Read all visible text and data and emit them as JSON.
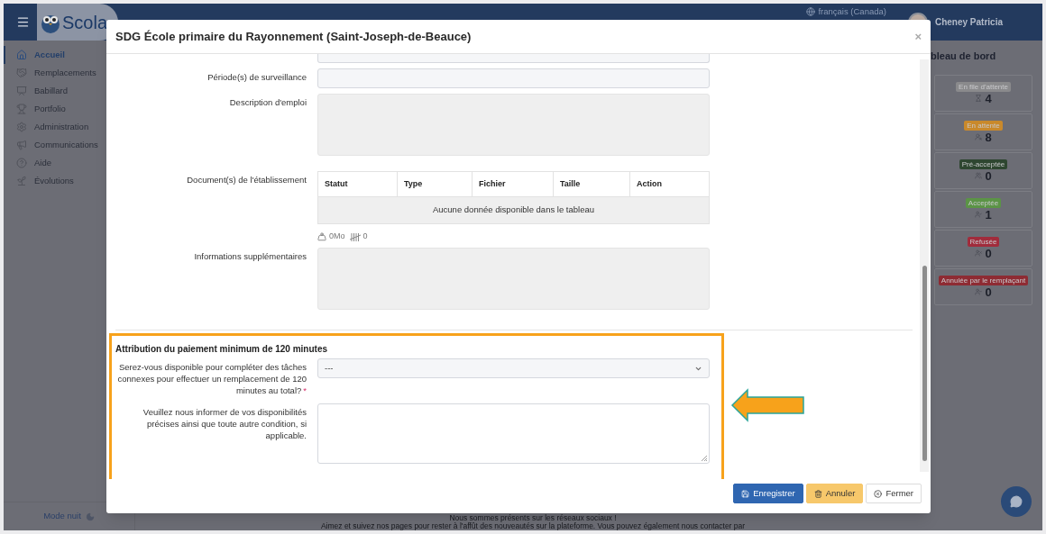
{
  "app": {
    "brand": "Scola",
    "language": "français (Canada)",
    "user": "Cheney Patricia"
  },
  "sidebar": {
    "items": [
      {
        "label": "Accueil",
        "selected": true
      },
      {
        "label": "Remplacements",
        "selected": false
      },
      {
        "label": "Babillard",
        "selected": false
      },
      {
        "label": "Portfolio",
        "selected": false
      },
      {
        "label": "Administration",
        "selected": false
      },
      {
        "label": "Communications",
        "selected": false
      },
      {
        "label": "Aide",
        "selected": false
      },
      {
        "label": "Évolutions",
        "selected": false
      }
    ],
    "night_mode": "Mode nuit"
  },
  "dashboard": {
    "title": "bleau de bord",
    "cards": [
      {
        "label": "En file d'attente",
        "count": "4",
        "color": "#8a8a8c"
      },
      {
        "label": "En attente",
        "count": "8",
        "color": "#c9892b"
      },
      {
        "label": "Pré-acceptée",
        "count": "0",
        "color": "#2e4630"
      },
      {
        "label": "Acceptée",
        "count": "1",
        "color": "#5b9446"
      },
      {
        "label": "Refusée",
        "count": "0",
        "color": "#a12c3c"
      },
      {
        "label": "Annulée par le remplaçant",
        "count": "0",
        "color": "#8e2b33"
      }
    ]
  },
  "footer_texts": [
    "Nous sommes présents sur les réseaux sociaux !",
    "Aimez et suivez nos pages pour rester à l'affût des nouveautés sur la plateforme. Vous pouvez également nous contacter par"
  ],
  "modal": {
    "title": "SDG École primaire du Rayonnement (Saint-Joseph-de-Beauce)",
    "close": "×",
    "fields": [
      {
        "kind": "input",
        "label": "Période(s) de surveillance"
      },
      {
        "kind": "textarea",
        "label": "Description d'emploi"
      },
      {
        "kind": "table",
        "label": "Document(s) de l'établissement",
        "columns": [
          "Statut",
          "Type",
          "Fichier",
          "Taille",
          "Action"
        ],
        "empty": "Aucune donnée disponible dans le tableau",
        "size": "0Mo",
        "count": "0"
      },
      {
        "kind": "textarea",
        "label": "Informations supplémentaires"
      }
    ],
    "section": {
      "title": "Attribution du paiement minimum de 120 minutes",
      "fields": [
        {
          "kind": "select",
          "label": "Serez-vous disponible pour compléter des tâches connexes pour effectuer un remplacement de 120 minutes au total?",
          "required_mark": "*",
          "value": "---"
        },
        {
          "kind": "editable",
          "label": "Veuillez nous informer de vos disponibilités précises ainsi que toute autre condition, si applicable."
        }
      ]
    },
    "buttons": [
      {
        "label": "Enregistrer",
        "kind": "primary"
      },
      {
        "label": "Annuler",
        "kind": "warning"
      },
      {
        "label": "Fermer",
        "kind": "default"
      }
    ]
  }
}
